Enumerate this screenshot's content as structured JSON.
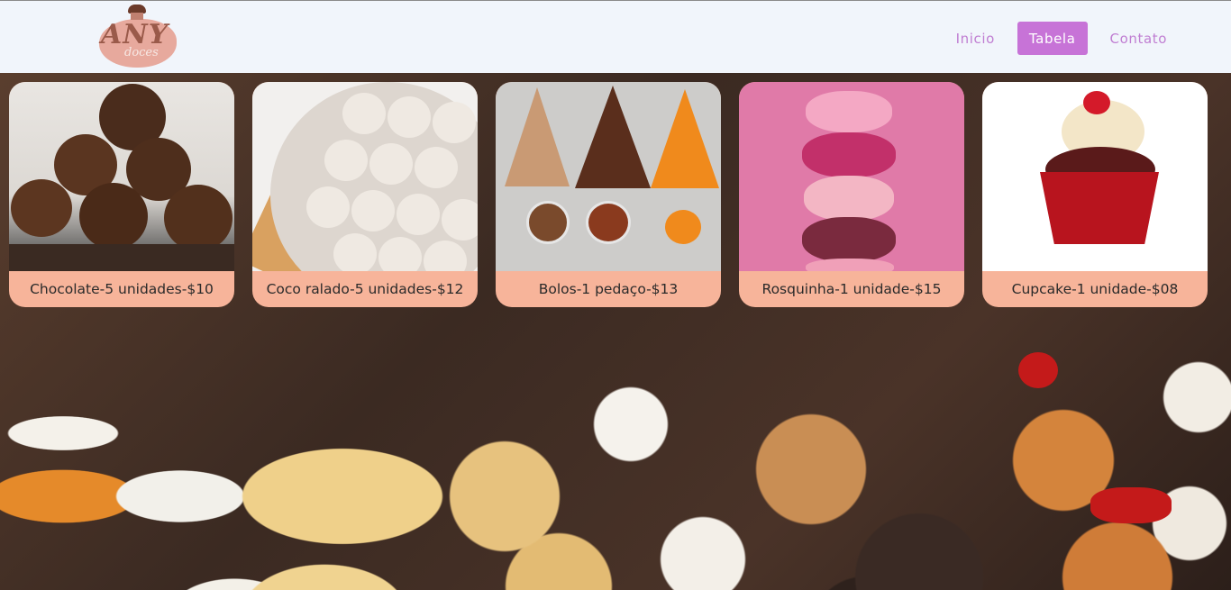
{
  "header": {
    "logo": {
      "text": "ANY",
      "subtext": "doces"
    },
    "nav": [
      {
        "label": "Inicio",
        "active": false
      },
      {
        "label": "Tabela",
        "active": true
      },
      {
        "label": "Contato",
        "active": false
      }
    ]
  },
  "products": [
    {
      "label": "Chocolate-5 unidades-$10",
      "image": "chocolate-truffles"
    },
    {
      "label": "Coco ralado-5 unidades-$12",
      "image": "coconut-balls"
    },
    {
      "label": "Bolos-1 pedaço-$13",
      "image": "cake-slices"
    },
    {
      "label": "Rosquinha-1 unidade-$15",
      "image": "donut-stack"
    },
    {
      "label": "Cupcake-1 unidade-$08",
      "image": "cupcake"
    }
  ],
  "colors": {
    "header_bg": "#f1f5fb",
    "nav_text": "#c07ed2",
    "nav_active_bg": "#c773d7",
    "card_label_bg": "#f7b49a"
  }
}
